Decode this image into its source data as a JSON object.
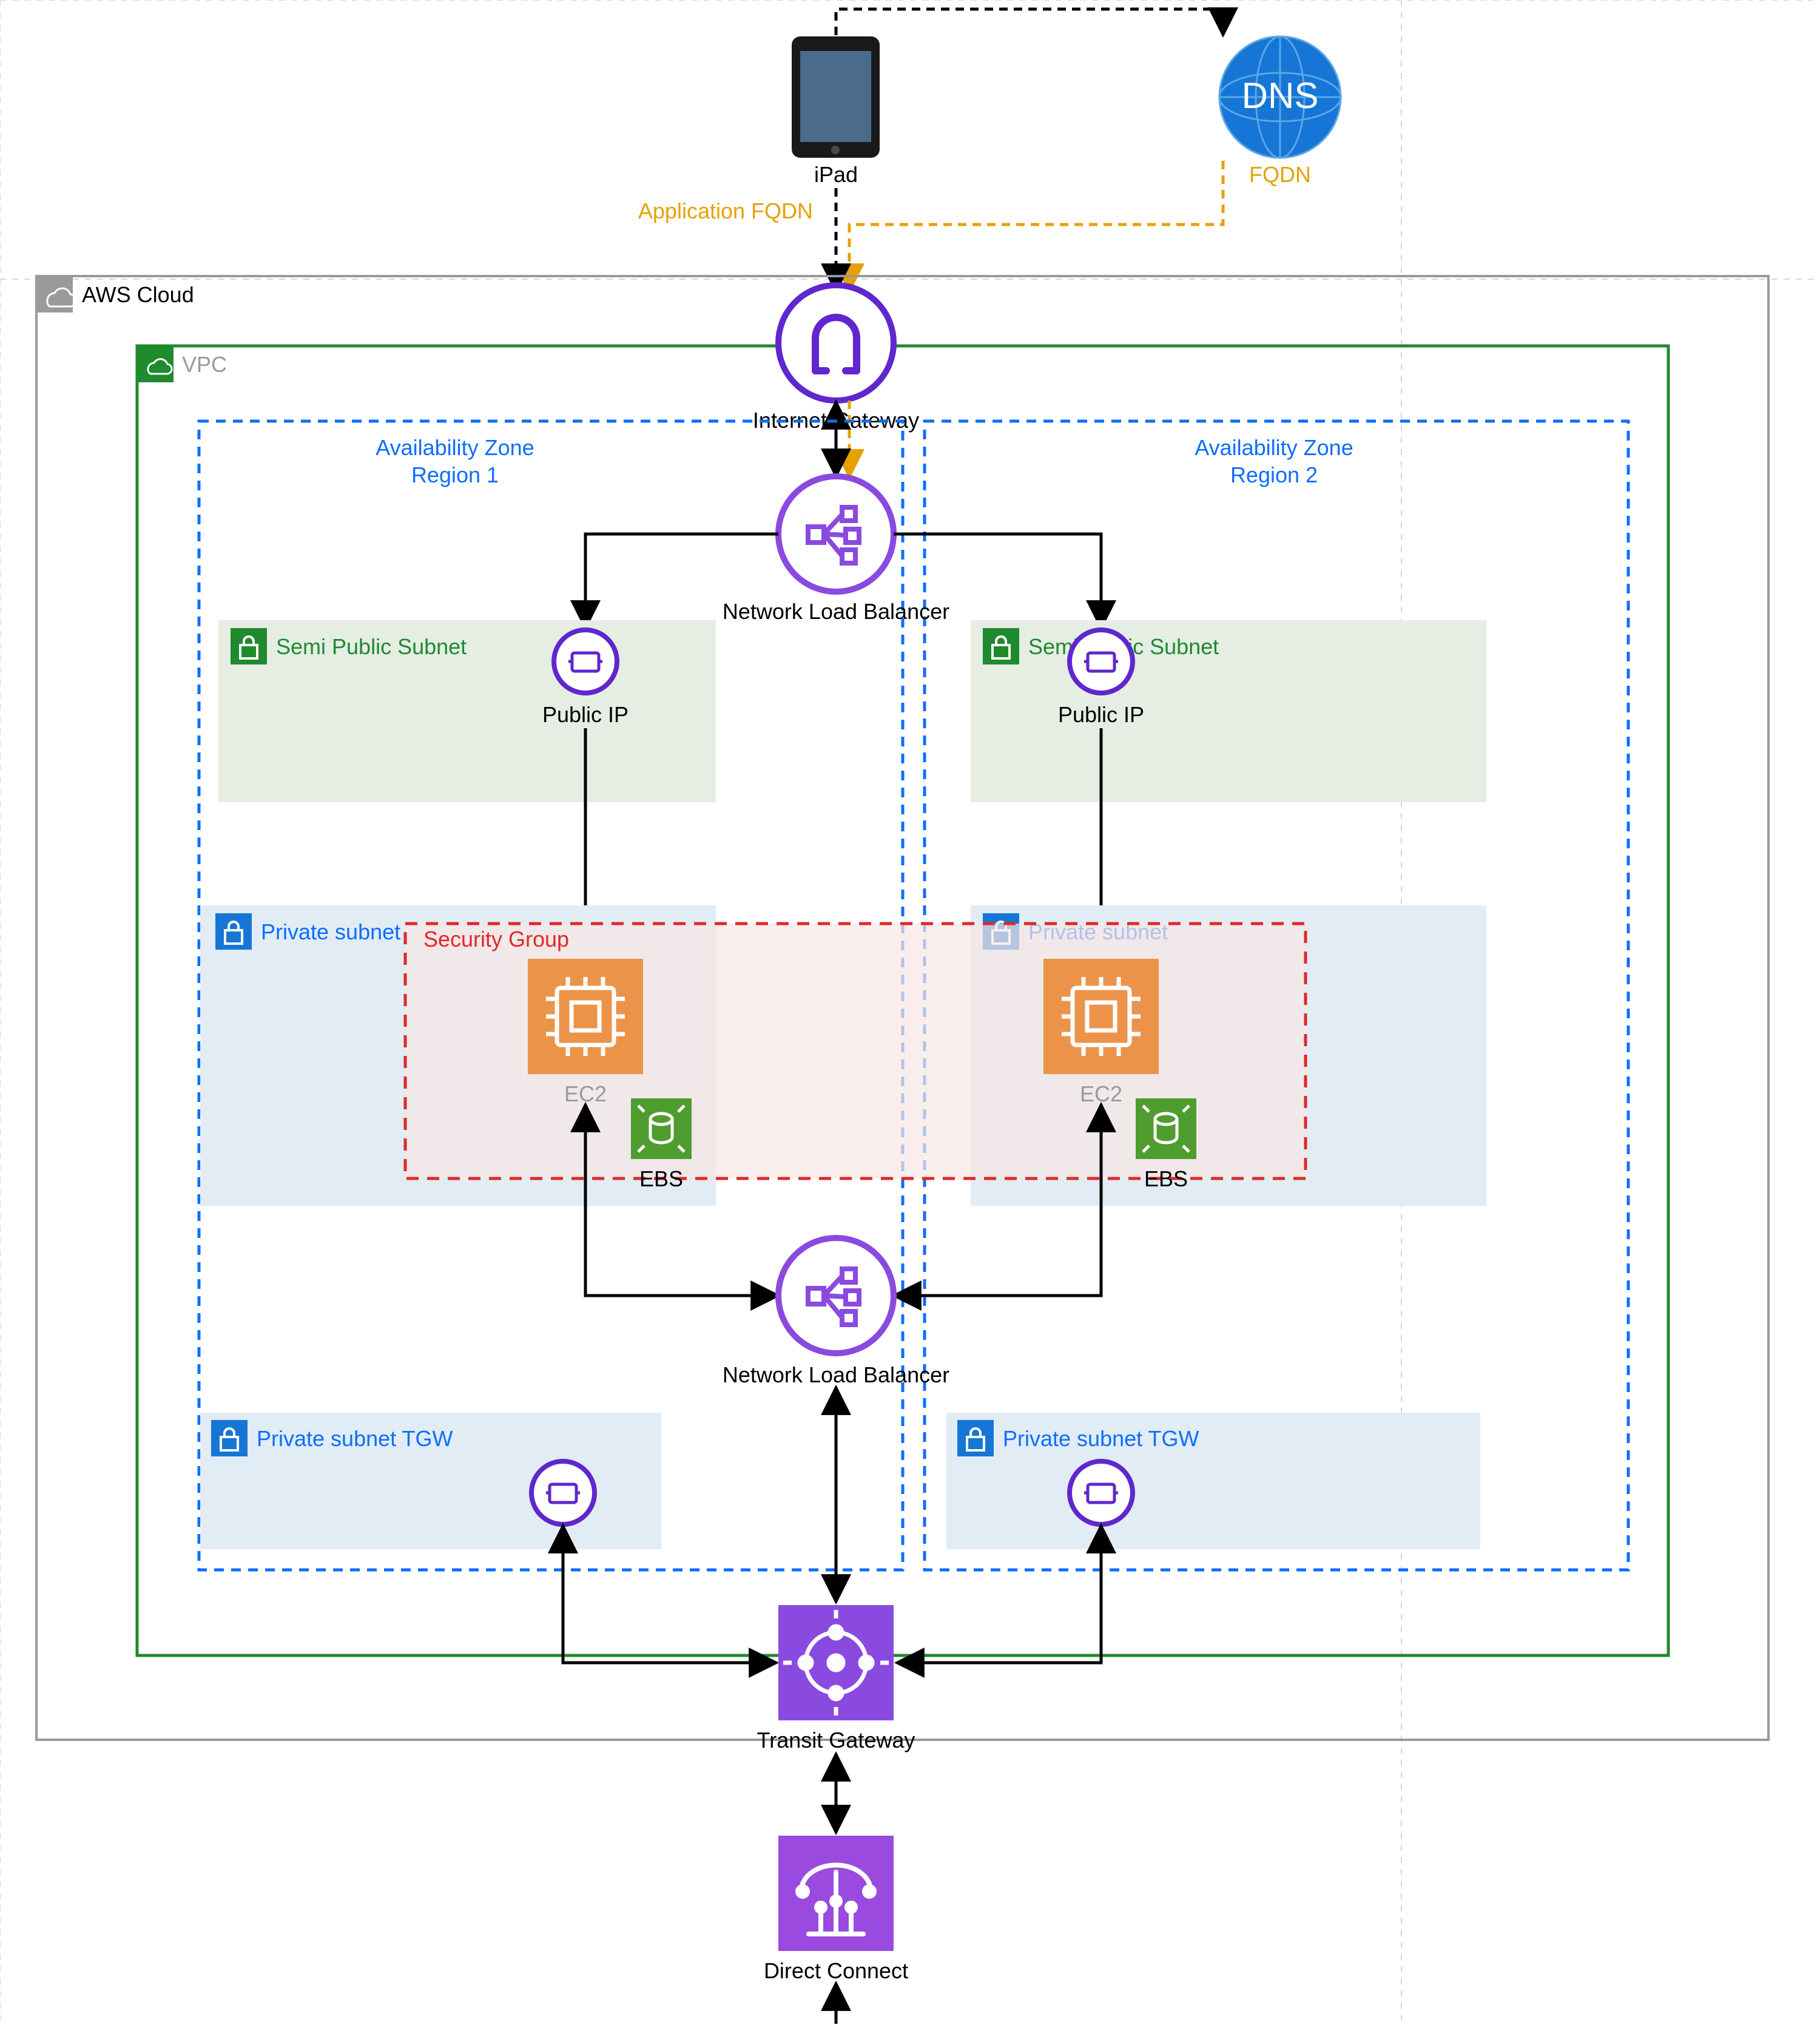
{
  "top": {
    "ipad": "iPad",
    "dns": "DNS",
    "fqdn": "FQDN",
    "app_fqdn": "Application FQDN"
  },
  "containers": {
    "aws_cloud": "AWS Cloud",
    "vpc": "VPC",
    "az1_line1": "Availability Zone",
    "az1_line2": "Region 1",
    "az2_line1": "Availability Zone",
    "az2_line2": "Region 2",
    "semi_public_subnet_1": "Semi Public Subnet",
    "semi_public_subnet_2": "Semi Public Subnet",
    "private_subnet_1": "Private subnet",
    "private_subnet_2": "Private subnet",
    "private_subnet_tgw_1": "Private subnet TGW",
    "private_subnet_tgw_2": "Private subnet TGW",
    "security_group": "Security Group"
  },
  "nodes": {
    "internet_gateway": "Internet Gateway",
    "nlb_top": "Network Load Balancer",
    "nlb_bottom": "Network Load Balancer",
    "public_ip_1": "Public IP",
    "public_ip_2": "Public IP",
    "ec2_1": "EC2",
    "ec2_2": "EC2",
    "ebs_1": "EBS",
    "ebs_2": "EBS",
    "transit_gateway": "Transit Gateway",
    "direct_connect": "Direct Connect"
  },
  "colors": {
    "purple": "#7d3fe0",
    "purple_dark": "#5f27cd",
    "blue_dash": "#0d6efd",
    "green_box": "#1f8a2e",
    "green_fill": "#e6eee4",
    "blue_fill": "#e1ecf5",
    "red_dash": "#e02828",
    "red_fill": "#f8e7e4",
    "orange_ec2": "#ec934a",
    "green_ebs": "#4f9c2f",
    "orange_text": "#e6a100",
    "tgw_box": "#8a4adf",
    "dc_box": "#9a4adf",
    "dns_blue": "#1676d6",
    "gray": "#9a9a9a"
  }
}
